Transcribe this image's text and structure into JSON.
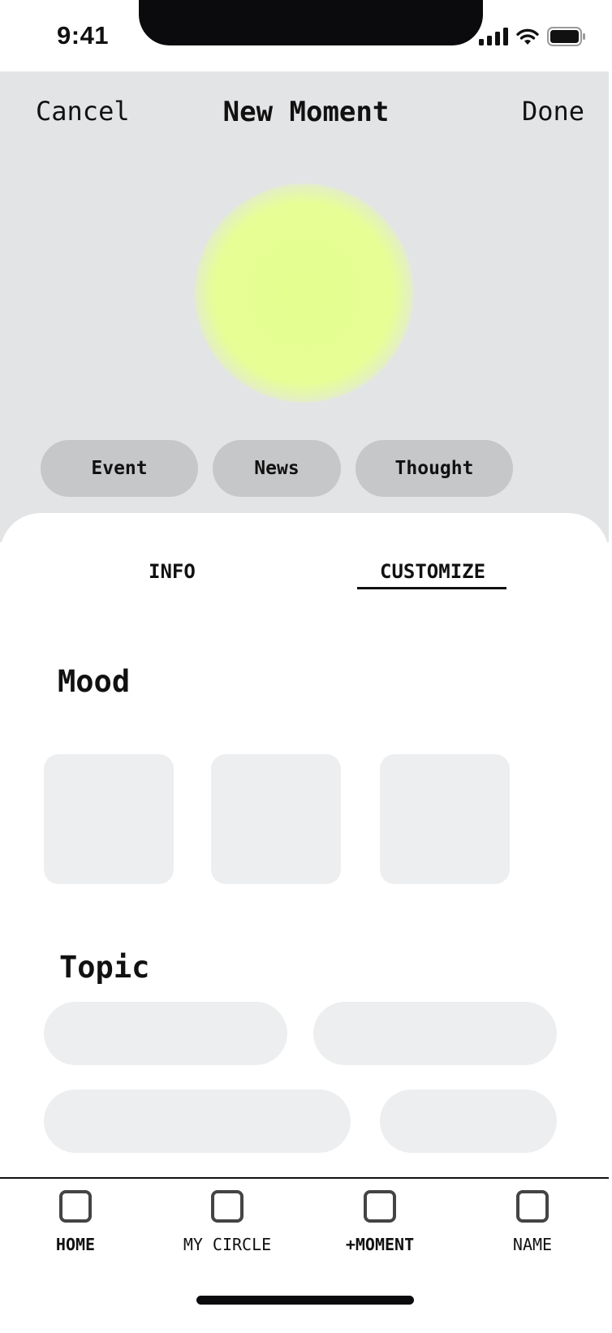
{
  "status_bar": {
    "time": "9:41",
    "icons": [
      "cellular-signal-icon",
      "wifi-icon",
      "battery-icon"
    ]
  },
  "nav": {
    "cancel_label": "Cancel",
    "title": "New Moment",
    "done_label": "Done"
  },
  "preview": {
    "blob_color": "#e6fe95"
  },
  "type_chips": [
    {
      "label": "Event"
    },
    {
      "label": "News"
    },
    {
      "label": "Thought"
    }
  ],
  "tabs": [
    {
      "label": "INFO",
      "selected": false
    },
    {
      "label": "CUSTOMIZE",
      "selected": true
    }
  ],
  "sections": {
    "mood_heading": "Mood",
    "topic_heading": "Topic"
  },
  "tab_bar": {
    "items": [
      {
        "label": "HOME",
        "icon": "square-icon",
        "bold": true
      },
      {
        "label": "MY CIRCLE",
        "icon": "square-icon",
        "bold": false
      },
      {
        "label": "+MOMENT",
        "icon": "square-icon",
        "bold": true
      },
      {
        "label": "NAME",
        "icon": "square-icon",
        "bold": false
      }
    ]
  },
  "colors": {
    "top_background": "#e3e4e6",
    "chip_background": "#c6c7c9",
    "placeholder_background": "#edeeef",
    "text": "#111111"
  }
}
